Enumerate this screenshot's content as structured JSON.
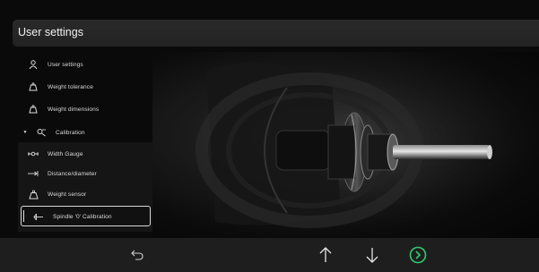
{
  "header": {
    "title": "User settings"
  },
  "sidebar": {
    "items": [
      {
        "label": "User settings",
        "icon": "user-icon"
      },
      {
        "label": "Weight tolerance",
        "icon": "weight-icon"
      },
      {
        "label": "Weight dimensions",
        "icon": "weight-icon"
      },
      {
        "label": "Calibration",
        "icon": "calibration-icon",
        "expanded": true
      },
      {
        "label": "Width Gauge",
        "icon": "width-gauge-icon"
      },
      {
        "label": "Distance/diameter",
        "icon": "distance-icon"
      },
      {
        "label": "Weight sensor",
        "icon": "weight-icon"
      },
      {
        "label": "Spindle '0' Calibration",
        "icon": "spindle-icon",
        "selected": true
      }
    ]
  },
  "footer": {
    "buttons": [
      "back-icon",
      "arrow-up-icon",
      "arrow-down-icon",
      "confirm-icon"
    ],
    "accent_color": "#2ecc71"
  }
}
